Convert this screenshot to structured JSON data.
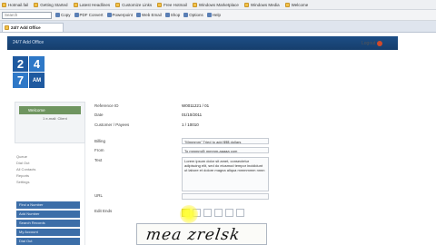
{
  "browser": {
    "bookmarks": [
      {
        "label": "Hotmail.fail"
      },
      {
        "label": "Getting Started"
      },
      {
        "label": "Latest Headlines"
      },
      {
        "label": "Customize Links"
      },
      {
        "label": "Free Hotmail"
      },
      {
        "label": "Windows Marketplace"
      },
      {
        "label": "Windows Media"
      },
      {
        "label": "Welcome"
      }
    ],
    "toolbar": {
      "search_placeholder": "Search",
      "buttons": [
        {
          "label": "Copy"
        },
        {
          "label": "PDF Convert"
        },
        {
          "label": "Powerpoint"
        },
        {
          "label": "Web Email"
        },
        {
          "label": "Shop"
        },
        {
          "label": "Options"
        },
        {
          "label": "Help"
        }
      ]
    },
    "tab": {
      "label": "24/7 Add Office"
    }
  },
  "app": {
    "header_title": "24/7 Add Office",
    "logout_label": "Logout",
    "logo": {
      "top_left": "2",
      "top_right": "4",
      "bottom_left": "7",
      "bottom_right": "AM"
    },
    "sidebar": {
      "box_head": "Welcome",
      "box_lines": [
        "1 e-mail: Client"
      ],
      "text_lines": [
        "Queue",
        "Dial Out",
        "All Contacts",
        "Reports",
        "Settings"
      ],
      "buttons": [
        "Find a Number",
        "Add Number",
        "Search Records",
        "My Account",
        "Dial Out"
      ]
    },
    "form": {
      "rows": [
        {
          "label": "Reference ID",
          "value": "W0011221 / 01"
        },
        {
          "label": "Date",
          "value": "01/10/2011"
        },
        {
          "label": "Customer / Payees",
          "value": "1 / 10010"
        }
      ],
      "billing_label": "Billing",
      "billing_value": "\"Mmmmm\" Tried to add $$$ dollars",
      "from_label": "From",
      "from_value": "To mmmm@ mmmm-aaaaa com",
      "text_label": "Text",
      "text_value": "Lorem ipsum dolor sit amet, consectetur adipiscing elit, sed do eiusmod tempor incididunt ut labore et dolore magna aliqua mmmmmm nnnn",
      "url_label": "URL",
      "url_value": "",
      "edit_label": "Edit Ends"
    },
    "captcha": {
      "text": "mea zrelsk"
    }
  }
}
